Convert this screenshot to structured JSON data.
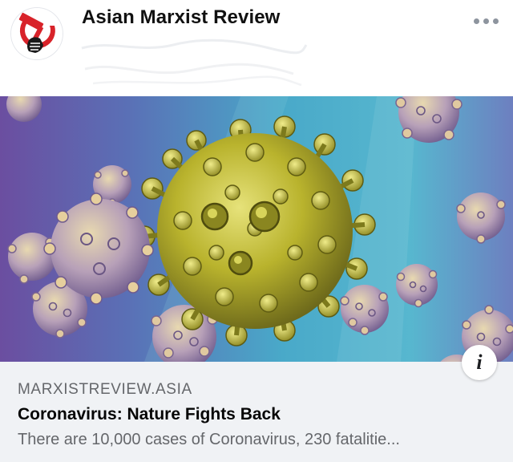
{
  "post": {
    "page_name": "Asian Marxist Review",
    "avatar_icon": "hammer-and-sickle-fist-logo",
    "more_icon": "more-options-icon"
  },
  "link_preview": {
    "image_subject": "coronavirus-particles-illustration",
    "info_icon": "info-icon",
    "info_glyph": "i",
    "domain": "MARXISTREVIEW.ASIA",
    "title": "Coronavirus: Nature Fights Back",
    "description": "There are 10,000 cases of Coronavirus, 230 fatalitie..."
  },
  "colors": {
    "logo_red": "#d8232a",
    "footer_background": "#f0f2f5",
    "secondary_text": "#65676b",
    "virus_yellow": "#c9c338",
    "background_blue": "#4aa6c9",
    "background_purple": "#6a4a9a"
  }
}
